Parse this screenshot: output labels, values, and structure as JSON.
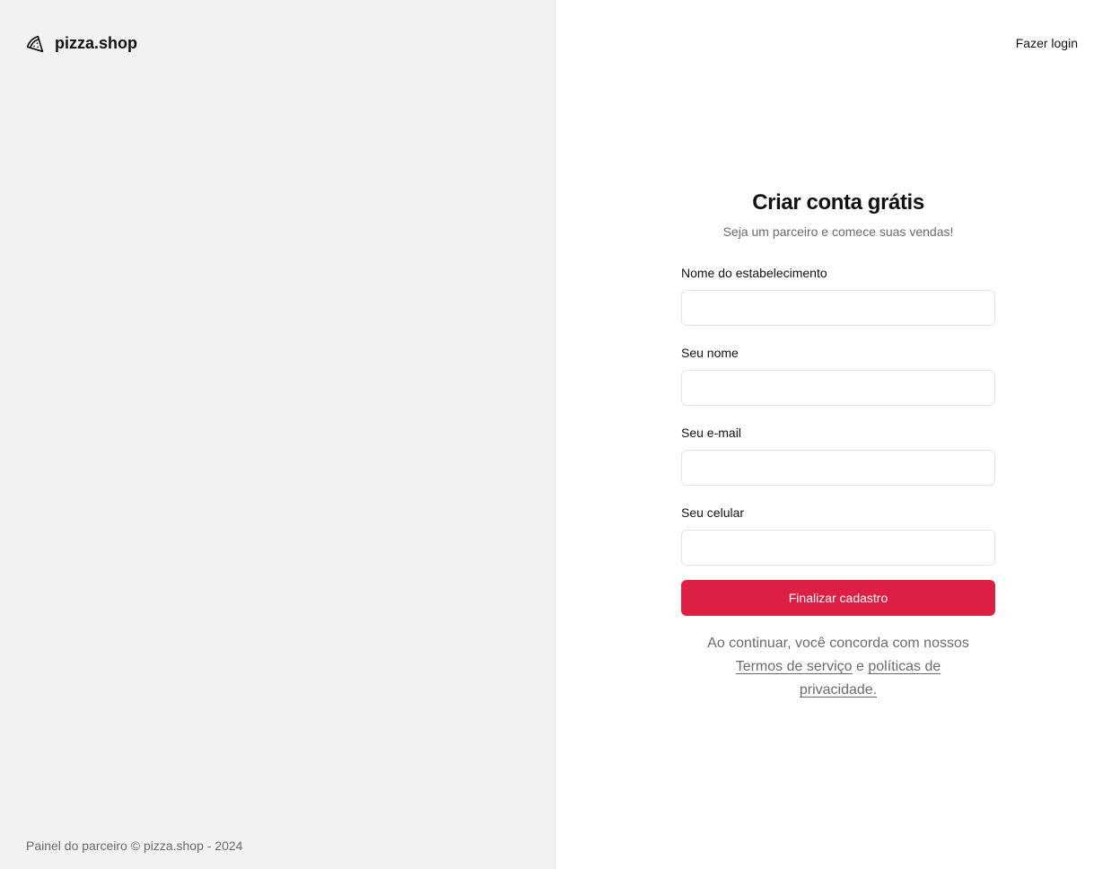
{
  "brand": {
    "icon": "pizza-slice-icon",
    "name": "pizza.shop"
  },
  "footer": {
    "text": "Painel do parceiro © pizza.shop - 2024"
  },
  "header": {
    "login_label": "Fazer login"
  },
  "form": {
    "title": "Criar conta grátis",
    "subtitle": "Seja um parceiro e comece suas vendas!",
    "fields": [
      {
        "label": "Nome do estabelecimento",
        "value": "",
        "placeholder": ""
      },
      {
        "label": "Seu nome",
        "value": "",
        "placeholder": ""
      },
      {
        "label": "Seu e-mail",
        "value": "",
        "placeholder": ""
      },
      {
        "label": "Seu celular",
        "value": "",
        "placeholder": ""
      }
    ],
    "submit_label": "Finalizar cadastro",
    "terms": {
      "prefix": "Ao continuar, você concorda com nossos",
      "terms_link": "Termos de serviço",
      "conjunction": "e",
      "privacy_link": "políticas de privacidade."
    }
  },
  "colors": {
    "accent": "#dd1f43",
    "left_panel_bg": "#f2f2f2"
  }
}
